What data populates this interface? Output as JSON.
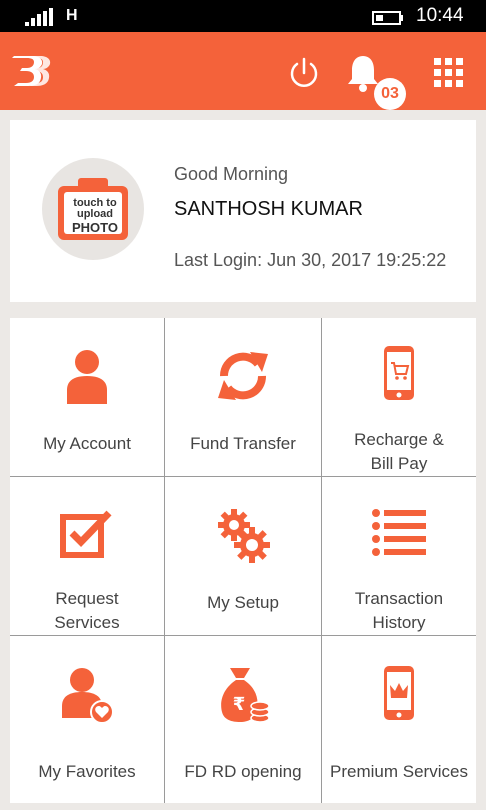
{
  "status_bar": {
    "network": "H",
    "time": "10:44",
    "icons": [
      "signal-icon",
      "battery-icon"
    ]
  },
  "header": {
    "logo": "bank-of-baroda-logo",
    "notification_count": "03",
    "icons": [
      "power-icon",
      "bell-icon",
      "grid-menu-icon"
    ],
    "brand_color": "#f4623a"
  },
  "profile": {
    "photo_line1": "touch to",
    "photo_line2": "upload",
    "photo_line3": "PHOTO",
    "greeting": "Good Morning",
    "name": "SANTHOSH KUMAR",
    "last_login": "Last Login: Jun 30, 2017 19:25:22"
  },
  "menu": {
    "my_account": "My Account",
    "fund_transfer": "Fund Transfer",
    "recharge_line1": "Recharge &",
    "recharge_line2": "Bill Pay",
    "request_line1": "Request",
    "request_line2": "Services",
    "my_setup": "My Setup",
    "transaction_line1": "Transaction",
    "transaction_line2": "History",
    "my_favorites": "My Favorites",
    "fd_rd": "FD RD opening",
    "premium": "Premium Services",
    "icons": [
      "user-icon",
      "refresh-transfer-icon",
      "phone-cart-icon",
      "checkbox-icon",
      "gears-icon",
      "list-icon",
      "user-heart-icon",
      "money-bag-icon",
      "phone-crown-icon"
    ]
  }
}
